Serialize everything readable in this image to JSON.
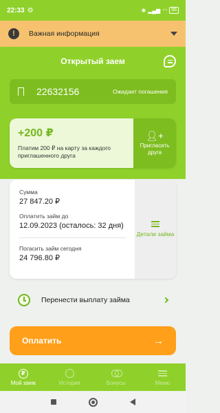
{
  "status_bar": {
    "time": "22:33",
    "battery": "96"
  },
  "notice": {
    "text": "Важная информация"
  },
  "header": {
    "title": "Открытый заем"
  },
  "loan": {
    "number": "22632156",
    "status": "Ожидает погашения"
  },
  "promo": {
    "amount": "+200 ₽",
    "description": "Платим 200 ₽ на карту за каждого приглашенного друга",
    "invite_label": "Пригласить друга"
  },
  "details": {
    "sum_label": "Сумма",
    "sum_value": "27 847.20 ₽",
    "pay_until_label": "Оплатить займ до",
    "pay_until_value": "12.09.2023 (осталось: 32 дня)",
    "today_label": "Погасить займ сегодня",
    "today_value": "24 796.80 ₽",
    "details_link": "Детали займа"
  },
  "postpone": {
    "label": "Перенести выплату займа"
  },
  "pay_button": {
    "label": "Оплатить",
    "arrow": "→"
  },
  "bottom_nav": {
    "items": [
      {
        "label": "Мой заем",
        "icon": "coin-icon"
      },
      {
        "label": "История",
        "icon": "history-icon"
      },
      {
        "label": "Бонусы",
        "icon": "bonus-icon"
      },
      {
        "label": "Меню",
        "icon": "menu-icon"
      }
    ]
  },
  "colors": {
    "brand_green": "#8fd12a",
    "dark_green": "#7dbd1f",
    "accent_orange": "#ff9f1a",
    "notice_orange": "#f6c26f"
  }
}
